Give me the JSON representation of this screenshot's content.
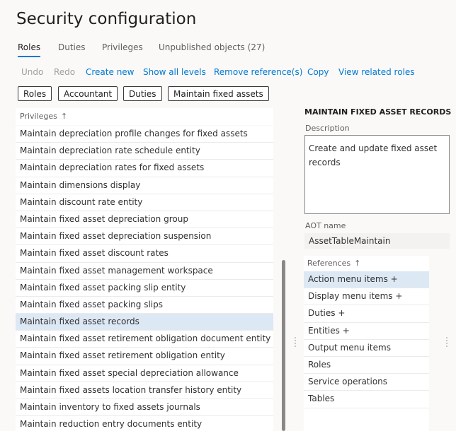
{
  "page": {
    "title": "Security configuration"
  },
  "tabs": [
    {
      "label": "Roles",
      "active": true
    },
    {
      "label": "Duties"
    },
    {
      "label": "Privileges"
    },
    {
      "label": "Unpublished objects (27)"
    }
  ],
  "actions": {
    "undo": "Undo",
    "redo": "Redo",
    "create_new": "Create new",
    "show_all_levels": "Show all levels",
    "remove_reference": "Remove reference(s)",
    "copy": "Copy",
    "view_related_roles": "View related roles"
  },
  "breadcrumb": [
    "Roles",
    "Accountant",
    "Duties",
    "Maintain fixed assets"
  ],
  "privileges": {
    "header": "Privileges",
    "sort_icon": "sort-up-arrow",
    "selected_index": 11,
    "rows": [
      "Maintain depreciation profile changes for fixed assets",
      "Maintain depreciation rate schedule entity",
      "Maintain depreciation rates for fixed assets",
      "Maintain dimensions display",
      "Maintain discount rate entity",
      "Maintain fixed asset depreciation group",
      "Maintain fixed asset depreciation suspension",
      "Maintain fixed asset discount rates",
      "Maintain fixed asset management workspace",
      "Maintain fixed asset packing slip entity",
      "Maintain fixed asset packing slips",
      "Maintain fixed asset records",
      "Maintain fixed asset retirement obligation document entity",
      "Maintain fixed asset retirement obligation entity",
      "Maintain fixed asset special depreciation allowance",
      "Maintain fixed assets location transfer history entity",
      "Maintain inventory to fixed assets journals",
      "Maintain reduction entry documents entity"
    ]
  },
  "detail": {
    "title": "MAINTAIN FIXED ASSET RECORDS",
    "description_label": "Description",
    "description": "Create and update fixed asset records",
    "aot_label": "AOT name",
    "aot_value": "AssetTableMaintain"
  },
  "references": {
    "header": "References",
    "selected_index": 0,
    "rows": [
      "Action menu items +",
      "Display menu items +",
      "Duties +",
      "Entities +",
      "Output menu items",
      "Roles",
      "Service operations",
      "Tables"
    ]
  },
  "colors": {
    "accent": "#0078d4",
    "selected_row": "#dde8f5"
  }
}
